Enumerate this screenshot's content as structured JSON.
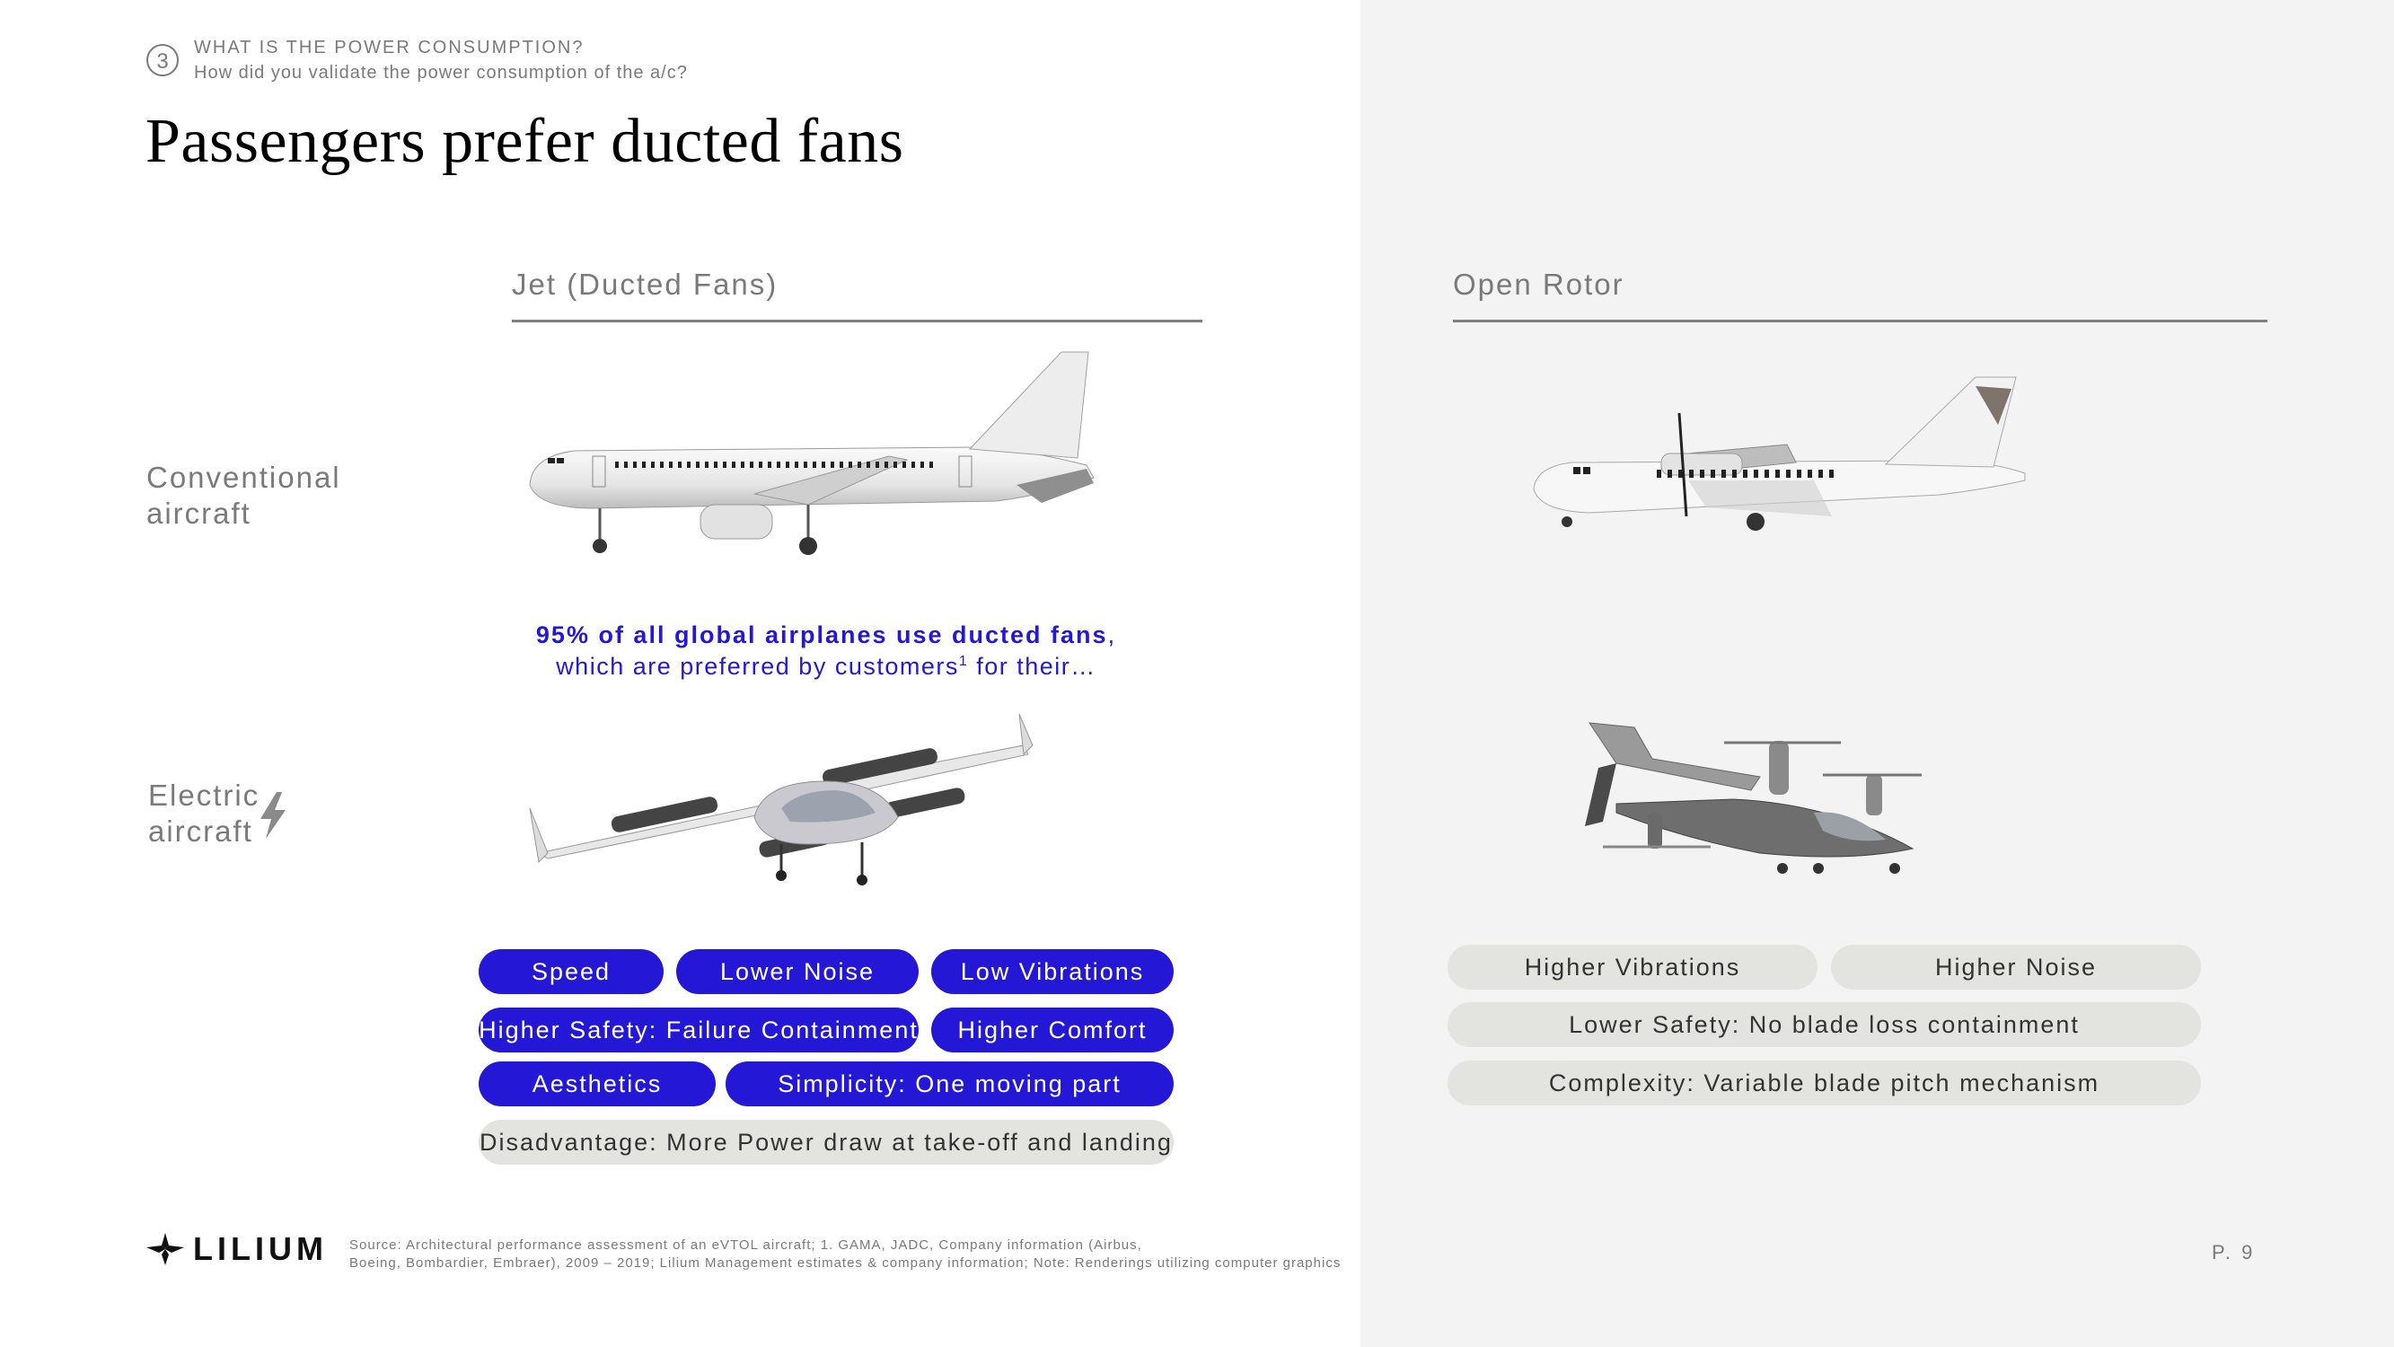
{
  "header": {
    "step_number": "3",
    "section": "WHAT IS THE POWER CONSUMPTION?",
    "question": "How did you validate the power consumption of the a/c?"
  },
  "title": "Passengers prefer ducted fans",
  "columns": {
    "left": "Jet (Ducted Fans)",
    "right": "Open Rotor"
  },
  "rows": {
    "conventional": [
      "Conventional",
      "aircraft"
    ],
    "electric": [
      "Electric",
      "aircraft"
    ],
    "electric_icon": "lightning-bolt-icon"
  },
  "images": {
    "jet_conventional": "airliner-jet-side-view",
    "jet_electric": "lilium-jet-evtol",
    "rotor_conventional": "turboprop-side-view",
    "rotor_electric": "tiltrotor-evtol"
  },
  "callout": {
    "line1": "95% of all global airplanes use ducted fans",
    "line1_suffix": ",",
    "line2_a": "which are preferred by customers",
    "line2_sup": "1",
    "line2_b": " for their…"
  },
  "advantages": [
    "Speed",
    "Lower Noise",
    "Low Vibrations",
    "Higher Safety: Failure Containment",
    "Higher Comfort",
    "Aesthetics",
    "Simplicity: One moving part"
  ],
  "disadvantage": "Disadvantage: More Power draw at take-off and landing",
  "open_rotor_drawbacks": [
    "Higher Vibrations",
    "Higher Noise",
    "Lower Safety: No blade loss containment",
    "Complexity: Variable blade pitch mechanism"
  ],
  "footer": {
    "logo_text": "LILIUM",
    "source_line1": "Source: Architectural performance assessment of an eVTOL aircraft; 1. GAMA, JADC, Company information (Airbus,",
    "source_line2": "Boeing, Bombardier, Embraer), 2009 – 2019; Lilium Management estimates & company information; Note: Renderings utilizing computer graphics",
    "page": "P. 9"
  },
  "colors": {
    "accent_blue": "#2418d6",
    "pill_grey": "#e3e3e0",
    "panel_grey": "#f3f3f3",
    "text_grey": "#7a7a7a"
  }
}
